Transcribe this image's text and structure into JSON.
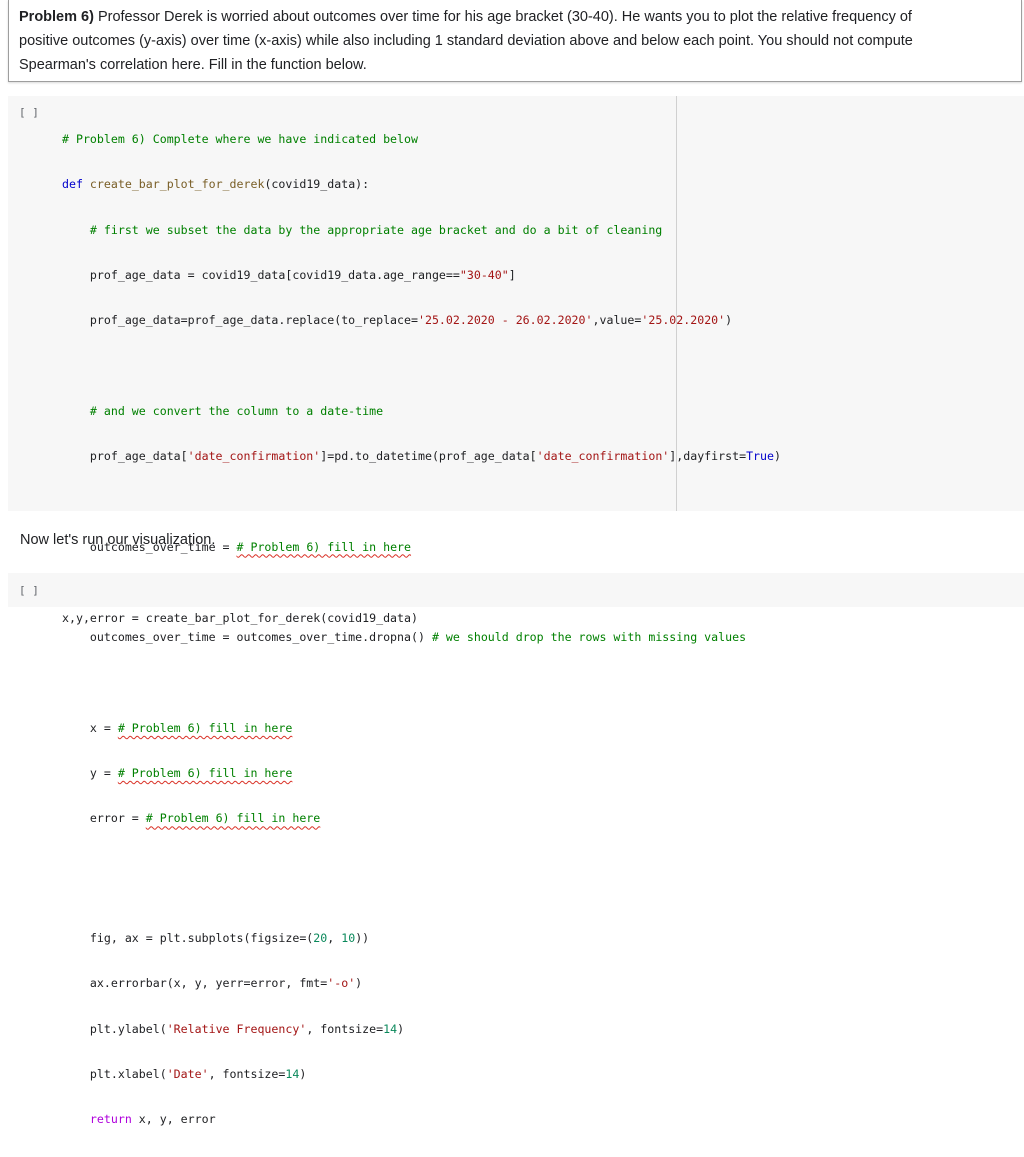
{
  "problem": {
    "label": "Problem 6)",
    "line1": " Professor Derek is worried about outcomes over time for his age bracket (30-40). He wants you to plot the relative frequency of",
    "line2": "positive outcomes (y-axis) over time (x-axis) while also including 1 standard deviation above and below each point. You should not compute",
    "line3": "Spearman's correlation here. Fill in the function below."
  },
  "cell1": {
    "run_label": "[ ]",
    "lines": {
      "l1": "# Problem 6) Complete where we have indicated below",
      "l2a": "def",
      "l2b": " create_bar_plot_for_derek",
      "l2c": "(covid19_data):",
      "l3": "    # first we subset the data by the appropriate age bracket and do a bit of cleaning",
      "l4a": "    prof_age_data = covid19_data[covid19_data.age_range==",
      "l4b": "\"30-40\"",
      "l4c": "]",
      "l5a": "    prof_age_data=prof_age_data.replace(to_replace=",
      "l5b": "'25.02.2020 - 26.02.2020'",
      "l5c": ",value=",
      "l5d": "'25.02.2020'",
      "l5e": ")",
      "l7": "    # and we convert the column to a date-time",
      "l8a": "    prof_age_data[",
      "l8b": "'date_confirmation'",
      "l8c": "]=pd.to_datetime(prof_age_data[",
      "l8d": "'date_confirmation'",
      "l8e": "],dayfirst=",
      "l8f": "True",
      "l8g": ")",
      "l10a": "    outcomes_over_time = ",
      "l10b": "# Problem 6) fill in here",
      "l12a": "    outcomes_over_time = outcomes_over_time.dropna() ",
      "l12b": "# we should drop the rows with missing values",
      "l14a": "    x = ",
      "l14b": "# Problem 6) fill in here",
      "l15a": "    y = ",
      "l15b": "# Problem 6) fill in here",
      "l16a": "    error = ",
      "l16b": "# Problem 6) fill in here",
      "l18a": "    fig, ax = plt.subplots(figsize=(",
      "l18b": "20",
      "l18c": ", ",
      "l18d": "10",
      "l18e": "))",
      "l19a": "    ax.errorbar(x, y, yerr=error, fmt=",
      "l19b": "'-o'",
      "l19c": ")",
      "l20a": "    plt.ylabel(",
      "l20b": "'Relative Frequency'",
      "l20c": ", fontsize=",
      "l20d": "14",
      "l20e": ")",
      "l21a": "    plt.xlabel(",
      "l21b": "'Date'",
      "l21c": ", fontsize=",
      "l21d": "14",
      "l21e": ")",
      "l22a": "    return",
      "l22b": " x, y, error"
    }
  },
  "markdown": {
    "text": "Now let's run our visualization."
  },
  "cell2": {
    "run_label": "[ ]",
    "code": "x,y,error = create_bar_plot_for_derek(covid19_data)"
  }
}
